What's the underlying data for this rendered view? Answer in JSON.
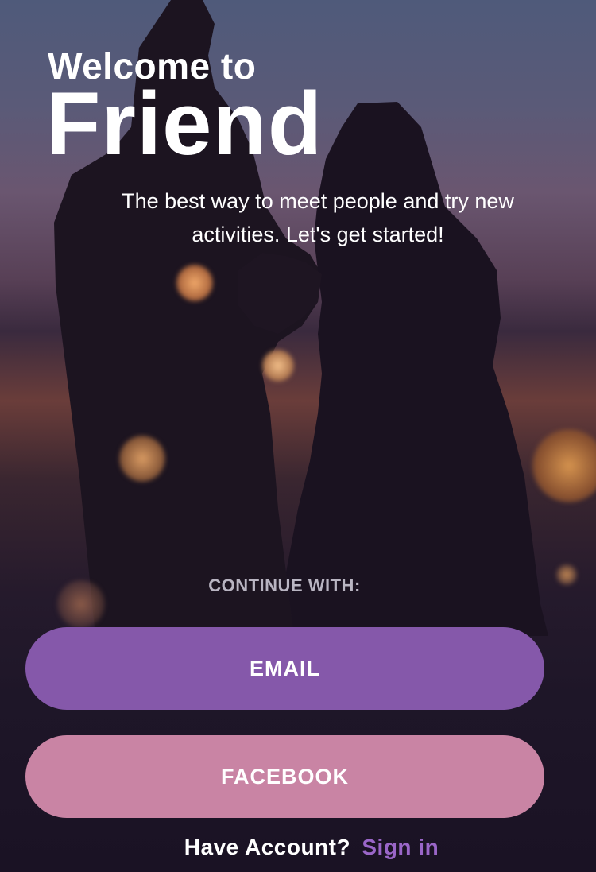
{
  "header": {
    "welcome_line": "Welcome to",
    "app_name": "Friend"
  },
  "intro": {
    "tagline": "The best way to meet people and try new activities. Let's get started!"
  },
  "auth": {
    "continue_label": "CONTINUE WITH:",
    "email_button": "EMAIL",
    "facebook_button": "FACEBOOK",
    "have_account_text": "Have Account?",
    "sign_in_link": "Sign in"
  },
  "colors": {
    "email_button": "#8558aa",
    "facebook_button": "#c984a4",
    "sign_in_link": "#9a66c8",
    "text": "#ffffff"
  }
}
